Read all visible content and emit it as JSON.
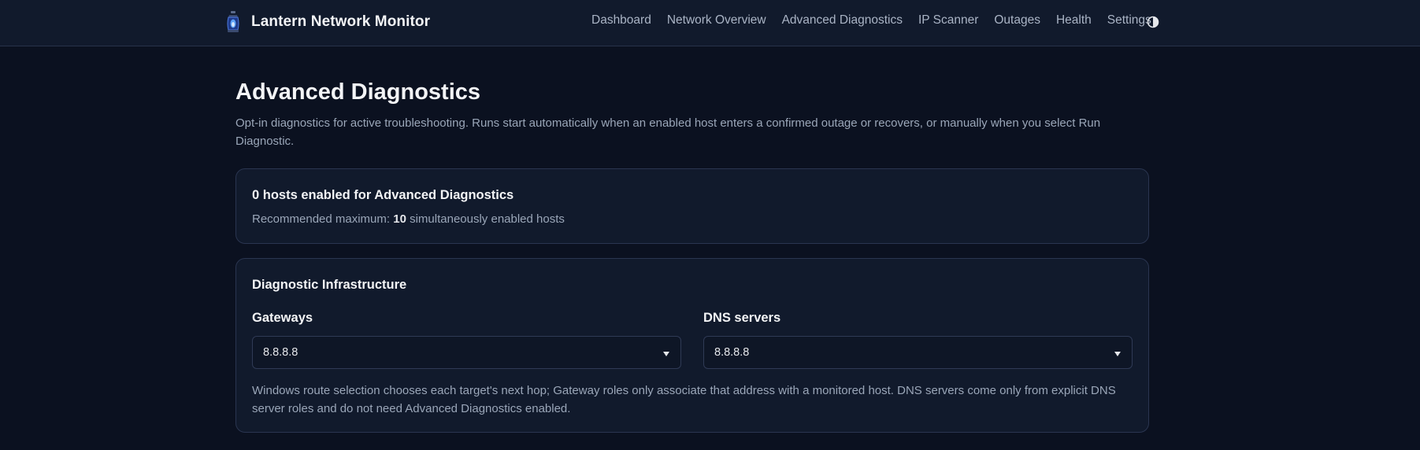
{
  "app": {
    "title": "Lantern Network Monitor",
    "logo_icon": "lantern-icon"
  },
  "nav": {
    "items": [
      {
        "label": "Dashboard"
      },
      {
        "label": "Network Overview"
      },
      {
        "label": "Advanced Diagnostics"
      },
      {
        "label": "IP Scanner"
      },
      {
        "label": "Outages"
      },
      {
        "label": "Health"
      },
      {
        "label": "Settings"
      }
    ],
    "theme_toggle_icon": "contrast-icon"
  },
  "page": {
    "title": "Advanced Diagnostics",
    "subtitle": "Opt-in diagnostics for active troubleshooting. Runs start automatically when an enabled host enters a confirmed outage or recovers, or manually when you select Run Diagnostic."
  },
  "summary": {
    "heading": "0 hosts enabled for Advanced Diagnostics",
    "recommended_prefix": "Recommended maximum: ",
    "recommended_value": "10",
    "recommended_suffix": " simultaneously enabled hosts"
  },
  "infrastructure": {
    "heading": "Diagnostic Infrastructure",
    "gateways_label": "Gateways",
    "gateways_value": "8.8.8.8",
    "dns_label": "DNS servers",
    "dns_value": "8.8.8.8",
    "note": "Windows route selection chooses each target's next hop; Gateway roles only associate that address with a monitored host. DNS servers come only from explicit DNS server roles and do not need Advanced Diagnostics enabled."
  },
  "colors": {
    "background": "#0b1120",
    "surface": "#111a2c",
    "border": "#2a3550",
    "text_primary": "#f3f4f6",
    "text_muted": "#9aa6b8",
    "lantern_glow": "#3b82f6"
  }
}
